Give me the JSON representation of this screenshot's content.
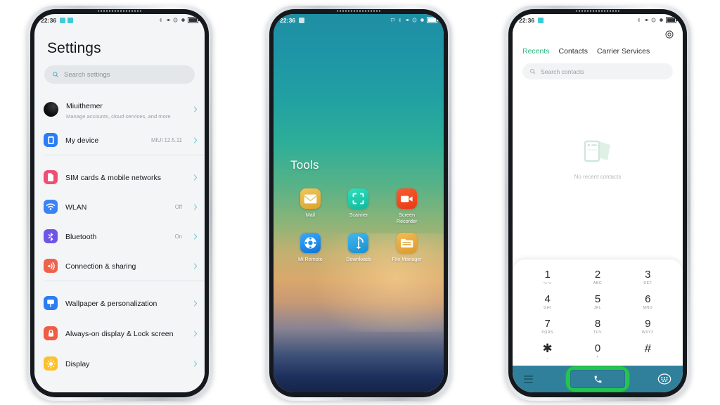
{
  "phones": [
    {
      "id": "settings-phone",
      "status_bar": {
        "time": "22:36",
        "left_icons": [
          "app-badge-icon",
          "app-badge-icon"
        ],
        "right_icons": [
          "bluetooth-icon",
          "vibrate-icon",
          "dnd-icon",
          "signal-icon",
          "battery-icon"
        ]
      },
      "screen": {
        "title": "Settings",
        "search": {
          "placeholder": "Search settings",
          "icon": "search-icon"
        },
        "groups": [
          {
            "rows": [
              {
                "icon": "account-avatar-icon",
                "label": "Miuithemer",
                "sub": "Manage accounts, cloud services, and more",
                "value": "",
                "color": "#111111"
              },
              {
                "icon": "my-device-icon",
                "label": "My device",
                "sub": "",
                "value": "MIUI 12.5.11",
                "color": "#2b7cf6"
              }
            ]
          },
          {
            "rows": [
              {
                "icon": "sim-card-icon",
                "label": "SIM cards & mobile networks",
                "sub": "",
                "value": "",
                "color": "#ef4f73"
              },
              {
                "icon": "wifi-icon",
                "label": "WLAN",
                "sub": "",
                "value": "Off",
                "color": "#3b82f6"
              },
              {
                "icon": "bluetooth-icon",
                "label": "Bluetooth",
                "sub": "",
                "value": "On",
                "color": "#7053e8"
              },
              {
                "icon": "connection-sharing-icon",
                "label": "Connection & sharing",
                "sub": "",
                "value": "",
                "color": "#f0614b"
              }
            ]
          },
          {
            "rows": [
              {
                "icon": "wallpaper-icon",
                "label": "Wallpaper & personalization",
                "sub": "",
                "value": "",
                "color": "#2b7cf6"
              },
              {
                "icon": "lock-screen-icon",
                "label": "Always-on display & Lock screen",
                "sub": "",
                "value": "",
                "color": "#ef5b45"
              },
              {
                "icon": "display-brightness-icon",
                "label": "Display",
                "sub": "",
                "value": "",
                "color": "#fbc02d"
              }
            ]
          }
        ]
      }
    },
    {
      "id": "home-folder-phone",
      "status_bar": {
        "time": "22:36",
        "left_icons": [
          "app-badge-icon"
        ],
        "right_icons": [
          "cast-icon",
          "bluetooth-icon",
          "vibrate-icon",
          "dnd-icon",
          "signal-icon",
          "battery-icon"
        ]
      },
      "screen": {
        "folder_title": "Tools",
        "apps": [
          {
            "name": "Mail",
            "icon": "mail-icon",
            "color": "#e7b33e"
          },
          {
            "name": "Scanner",
            "icon": "scanner-icon",
            "color": "#17c9ad"
          },
          {
            "name": "Screen Recorder",
            "icon": "screen-recorder-icon",
            "color": "#f14624"
          },
          {
            "name": "Mi Remote",
            "icon": "mi-remote-icon",
            "color": "#1e8ff0"
          },
          {
            "name": "Downloads",
            "icon": "downloads-icon",
            "color": "#2aa3e0"
          },
          {
            "name": "File Manager",
            "icon": "file-manager-icon",
            "color": "#eaa93c"
          }
        ]
      }
    },
    {
      "id": "dialer-phone",
      "status_bar": {
        "time": "22:36",
        "left_icons": [
          "app-badge-icon"
        ],
        "right_icons": [
          "bluetooth-icon",
          "vibrate-icon",
          "dnd-icon",
          "signal-icon",
          "battery-icon"
        ]
      },
      "screen": {
        "settings_icon": "gear-icon",
        "tabs": [
          {
            "label": "Recents",
            "active": true
          },
          {
            "label": "Contacts",
            "active": false
          },
          {
            "label": "Carrier Services",
            "active": false
          }
        ],
        "search": {
          "placeholder": "Search contacts",
          "icon": "search-icon"
        },
        "empty_state": {
          "icon": "no-contacts-illustration",
          "message": "No recent contacts"
        },
        "keypad": [
          {
            "num": "1",
            "sub": "⌥⌥"
          },
          {
            "num": "2",
            "sub": "ABC"
          },
          {
            "num": "3",
            "sub": "DEF"
          },
          {
            "num": "4",
            "sub": "GHI"
          },
          {
            "num": "5",
            "sub": "JKL"
          },
          {
            "num": "6",
            "sub": "MNO"
          },
          {
            "num": "7",
            "sub": "PQRS"
          },
          {
            "num": "8",
            "sub": "TUV"
          },
          {
            "num": "9",
            "sub": "WXYZ"
          },
          {
            "num": "✱",
            "sub": ","
          },
          {
            "num": "0",
            "sub": "+"
          },
          {
            "num": "#",
            "sub": ""
          }
        ],
        "bottom_bar": {
          "menu_icon": "hamburger-menu-icon",
          "call_icon": "phone-call-icon",
          "keypad_icon": "dialpad-icon",
          "highlight_color": "#23c552",
          "bar_color": "#31809b"
        }
      }
    }
  ],
  "theme": {
    "accent_green": "#26b37e",
    "page_background": "#ffffff"
  }
}
